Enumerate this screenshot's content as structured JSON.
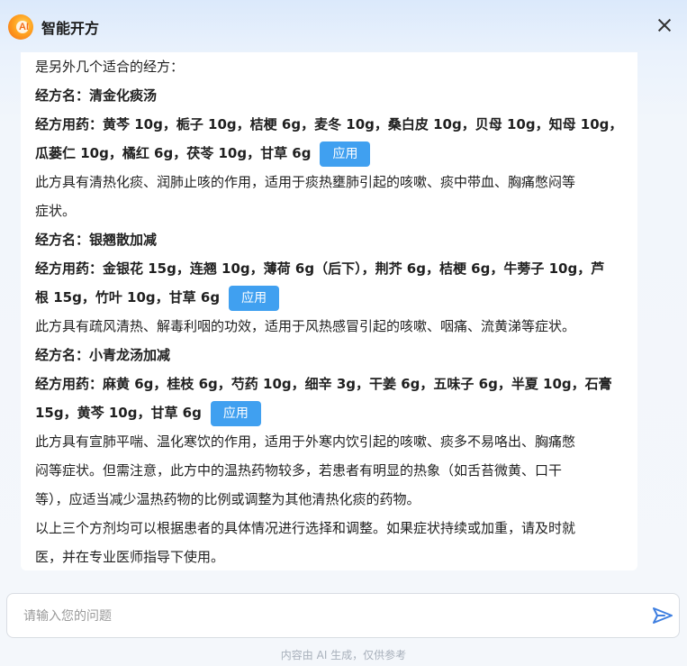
{
  "header": {
    "title": "智能开方",
    "logo_text": "AI"
  },
  "messages": [
    {
      "text": "是另外几个适合的经方：",
      "bold": false
    },
    {
      "text": "经方名：清金化痰汤",
      "bold": true
    },
    {
      "text": "经方用药：黄芩 10g，栀子 10g，桔梗 6g，麦冬 10g，桑白皮 10g，贝母 10g，知母 10g，",
      "bold": true
    },
    {
      "text": "瓜蒌仁 10g，橘红 6g，茯苓 10g，甘草 6g",
      "bold": true,
      "apply": "应用"
    },
    {
      "text": "此方具有清热化痰、润肺止咳的作用，适用于痰热壅肺引起的咳嗽、痰中带血、胸痛憋闷等",
      "bold": false
    },
    {
      "text": "症状。",
      "bold": false
    },
    {
      "text": "经方名：银翘散加减",
      "bold": true
    },
    {
      "text": "经方用药：金银花 15g，连翘 10g，薄荷 6g（后下），荆芥 6g，桔梗 6g，牛蒡子 10g，芦",
      "bold": true
    },
    {
      "text": "根 15g，竹叶 10g，甘草 6g",
      "bold": true,
      "apply": "应用"
    },
    {
      "text": "此方具有疏风清热、解毒利咽的功效，适用于风热感冒引起的咳嗽、咽痛、流黄涕等症状。",
      "bold": false
    },
    {
      "text": "经方名：小青龙汤加减",
      "bold": true
    },
    {
      "text": "经方用药：麻黄 6g，桂枝 6g，芍药 10g，细辛 3g，干姜 6g，五味子 6g，半夏 10g，石膏",
      "bold": true
    },
    {
      "text": "15g，黄芩 10g，甘草 6g",
      "bold": true,
      "apply": "应用"
    },
    {
      "text": "此方具有宣肺平喘、温化寒饮的作用，适用于外寒内饮引起的咳嗽、痰多不易咯出、胸痛憋",
      "bold": false
    },
    {
      "text": "闷等症状。但需注意，此方中的温热药物较多，若患者有明显的热象（如舌苔微黄、口干",
      "bold": false
    },
    {
      "text": "等），应适当减少温热药物的比例或调整为其他清热化痰的药物。",
      "bold": false
    },
    {
      "text": "以上三个方剂均可以根据患者的具体情况进行选择和调整。如果症状持续或加重，请及时就",
      "bold": false
    },
    {
      "text": "医，并在专业医师指导下使用。",
      "bold": false
    }
  ],
  "input": {
    "placeholder": "请输入您的问题",
    "value": ""
  },
  "footer": {
    "disclaimer": "内容由 AI 生成，仅供参考"
  },
  "colors": {
    "accent": "#40a0f0",
    "background": "#f4f7fb",
    "card": "#ffffff"
  },
  "icons": {
    "close": "close-icon",
    "send": "send-icon",
    "logo": "logo-icon"
  }
}
